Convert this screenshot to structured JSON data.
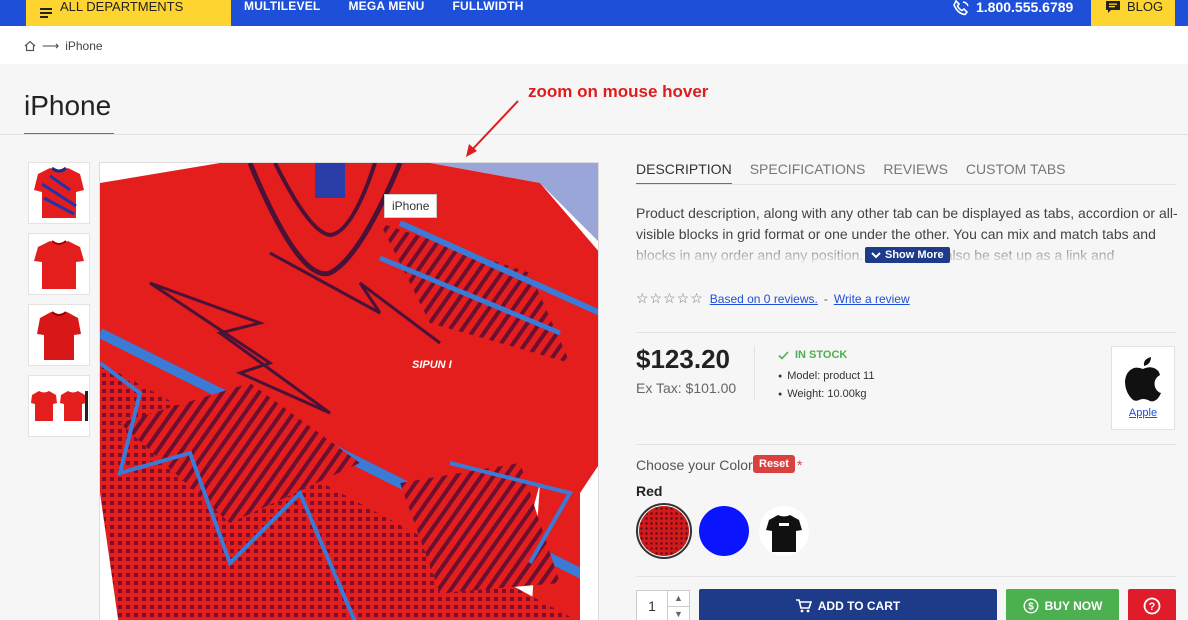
{
  "topbar": {
    "departments_label": "ALL DEPARTMENTS",
    "nav_items": [
      "MULTILEVEL",
      "MEGA MENU",
      "FULLWIDTH"
    ],
    "phone": "1.800.555.6789",
    "blog_label": "BLOG"
  },
  "breadcrumb": {
    "current": "iPhone"
  },
  "product": {
    "title": "iPhone",
    "image_tooltip": "iPhone",
    "annotation": "zoom on mouse hover"
  },
  "tabs": [
    "DESCRIPTION",
    "SPECIFICATIONS",
    "REVIEWS",
    "CUSTOM TABS"
  ],
  "description": "Product description, along with any other tab can be displayed as tabs, accordion or all-visible blocks in grid format or one under the other.  You can mix and match tabs and blocks in any order and any position. The tab can also be set up as a link and",
  "show_more": "Show More",
  "rating": {
    "stars": "☆☆☆☆☆",
    "reviews_link": "Based on 0 reviews.",
    "separator": "-",
    "write_link": "Write a review"
  },
  "price": {
    "value": "$123.20",
    "ex_tax": "Ex Tax: $101.00"
  },
  "stock": {
    "status": "IN STOCK",
    "model": "Model: product 11",
    "weight": "Weight: 10.00kg"
  },
  "brand": {
    "name": "Apple"
  },
  "options": {
    "label": "Choose your Color",
    "reset": "Reset",
    "required": "*",
    "selected": "Red",
    "colors": [
      "#d11a1a",
      "#0a14ff",
      "#111111"
    ]
  },
  "cart": {
    "quantity": "1",
    "add_to_cart": "ADD TO CART",
    "buy_now": "BUY NOW"
  },
  "colors": {
    "nav_blue": "#1e4fd8",
    "accent_yellow": "#fed530",
    "button_blue": "#1e3b8a",
    "buy_green": "#4caf50",
    "reset_red": "#d94141",
    "accent_orange": "#d35400"
  }
}
